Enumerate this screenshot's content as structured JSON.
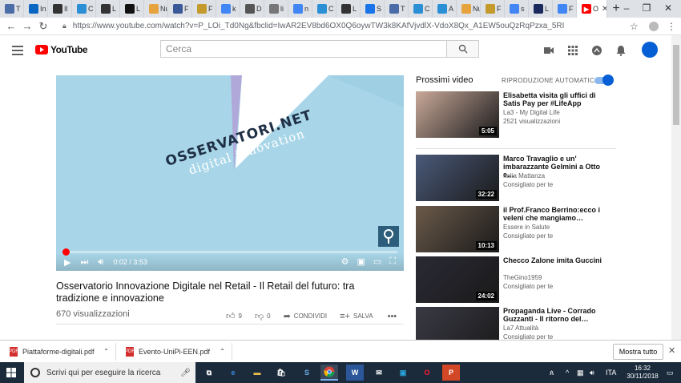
{
  "browser": {
    "tabs": [
      {
        "icon": "link-icon",
        "label": "T",
        "color": "#4a6da7"
      },
      {
        "icon": "linkedin-icon",
        "label": "In",
        "color": "#0a66c2"
      },
      {
        "icon": "document-icon",
        "label": "Il",
        "color": "#333333"
      },
      {
        "icon": "c-icon",
        "label": "C",
        "color": "#2b8fd6"
      },
      {
        "icon": "underline-icon",
        "label": "L",
        "color": "#333333"
      },
      {
        "icon": "s-icon",
        "label": "L",
        "color": "#111111"
      },
      {
        "icon": "folder-icon",
        "label": "Nuo",
        "color": "#e6a23c"
      },
      {
        "icon": "facebook-icon",
        "label": "F",
        "color": "#3b5998"
      },
      {
        "icon": "bird-icon",
        "label": "F",
        "color": "#c49a2c"
      },
      {
        "icon": "google-icon",
        "label": "k",
        "color": "#4285f4"
      },
      {
        "icon": "x-icon",
        "label": "D",
        "color": "#555555"
      },
      {
        "icon": "page-icon",
        "label": "li",
        "color": "#777777"
      },
      {
        "icon": "google-icon",
        "label": "n",
        "color": "#4285f4"
      },
      {
        "icon": "c-icon",
        "label": "C",
        "color": "#2b8fd6"
      },
      {
        "icon": "r-icon",
        "label": "L",
        "color": "#333333"
      },
      {
        "icon": "v-icon",
        "label": "S",
        "color": "#1a73e8"
      },
      {
        "icon": "link-icon",
        "label": "T",
        "color": "#4a6da7"
      },
      {
        "icon": "c-icon",
        "label": "C",
        "color": "#2b8fd6"
      },
      {
        "icon": "c-icon",
        "label": "A",
        "color": "#2b8fd6"
      },
      {
        "icon": "folder-icon",
        "label": "Nuo",
        "color": "#e6a23c"
      },
      {
        "icon": "bird-icon",
        "label": "F",
        "color": "#c49a2c"
      },
      {
        "icon": "google-icon",
        "label": "s",
        "color": "#4285f4"
      },
      {
        "icon": "media-icon",
        "label": "L",
        "color": "#1a2a5e"
      },
      {
        "icon": "google-icon",
        "label": "F",
        "color": "#4285f4"
      }
    ],
    "active_tab": {
      "label": "O",
      "close": "✕"
    },
    "new_tab": "+",
    "url": "https://www.youtube.com/watch?v=P_LOi_Td0Ng&fbclid=IwAR2EV8bd6OX0Q6oywTW3k8KAfVjvdlX-VdoX8Qx_A1EW5ouQzRqPzxa_5RI"
  },
  "youtube": {
    "logo_text": "YouTube",
    "search_placeholder": "Cerca",
    "video": {
      "watermark_line1": "OSSERVATORI.NET",
      "watermark_line2": "digital innovation",
      "time": "0:02 / 3:53",
      "progress": 0.01
    },
    "title": "Osservatorio Innovazione Digitale nel Retail - Il Retail del futuro: tra tradizione e innovazione",
    "views": "670 visualizzazioni",
    "likes": "9",
    "dislikes": "0",
    "share_label": "CONDIVIDI",
    "save_label": "SALVA",
    "sidebar_title": "Prossimi video",
    "autoplay_label": "RIPRODUZIONE AUTOMATICA",
    "autoplay_on": true,
    "recommendations": [
      {
        "title": "Elisabetta visita gli uffici di Satis Pay per #LifeApp",
        "channel": "La3 - My Digital Life",
        "meta": "2521 visualizzazioni",
        "duration": "5:05",
        "thumb_color": "#c9a999"
      },
      {
        "title": "Marco Travaglio e un' imbarazzante Gelmini a Otto e…",
        "channel": "Italia Mattanza",
        "meta": "Consigliato per te",
        "duration": "32:22",
        "thumb_color": "#4b5a7a"
      },
      {
        "title": "il Prof.Franco Berrino:ecco i veleni che mangiamo…",
        "channel": "Essere in Salute",
        "meta": "Consigliato per te",
        "duration": "10:13",
        "thumb_color": "#6b5a4a"
      },
      {
        "title": "Checco Zalone imita Guccini",
        "channel": "TheGino1959",
        "meta": "Consigliato per te",
        "duration": "24:02",
        "thumb_color": "#2a2a35"
      },
      {
        "title": "Propaganda Live - Corrado Guzzanti - Il ritorno del…",
        "channel": "La7 Attualità",
        "meta": "Consigliato per te",
        "duration": "",
        "thumb_color": "#3a3a45"
      }
    ]
  },
  "downloads": {
    "items": [
      {
        "name": "Piattaforme-digitali.pdf"
      },
      {
        "name": "Evento-UniPi-EEN.pdf"
      }
    ],
    "show_all": "Mostra tutto"
  },
  "taskbar": {
    "search_placeholder": "Scrivi qui per eseguire la ricerca",
    "language": "ITA",
    "time": "16:32",
    "date": "30/11/2018"
  },
  "colors": {
    "youtube_red": "#ff0000",
    "accent_blue": "#065fd4",
    "video_bg": "#a8d6e8"
  }
}
